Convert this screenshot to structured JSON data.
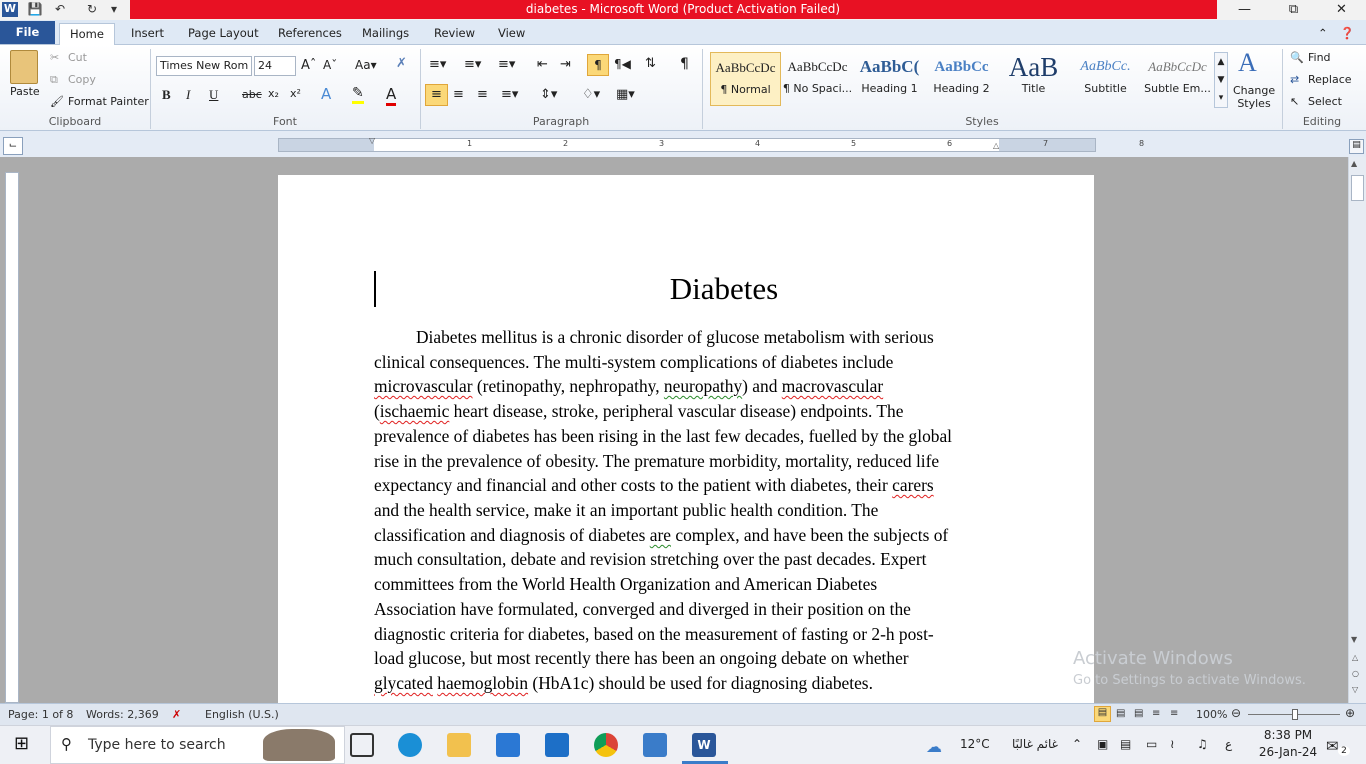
{
  "window": {
    "title": "diabetes - Microsoft Word (Product Activation Failed)"
  },
  "tabs": {
    "file": "File",
    "home": "Home",
    "insert": "Insert",
    "page_layout": "Page Layout",
    "references": "References",
    "mailings": "Mailings",
    "review": "Review",
    "view": "View"
  },
  "clipboard": {
    "paste": "Paste",
    "cut": "Cut",
    "copy": "Copy",
    "format_painter": "Format Painter",
    "label": "Clipboard"
  },
  "font": {
    "name": "Times New Rom",
    "size": "24",
    "label": "Font",
    "bold": "B",
    "italic": "I",
    "underline": "U",
    "strike": "abc",
    "subscript": "x₂",
    "superscript": "x²"
  },
  "paragraph": {
    "label": "Paragraph"
  },
  "styles": {
    "label": "Styles",
    "items": [
      {
        "preview": "AaBbCcDc",
        "name": "¶ Normal"
      },
      {
        "preview": "AaBbCcDc",
        "name": "¶ No Spaci..."
      },
      {
        "preview": "AaBbC(",
        "name": "Heading 1"
      },
      {
        "preview": "AaBbCc",
        "name": "Heading 2"
      },
      {
        "preview": "AaB",
        "name": "Title"
      },
      {
        "preview": "AaBbCc.",
        "name": "Subtitle"
      },
      {
        "preview": "AaBbCcDc",
        "name": "Subtle Em..."
      }
    ],
    "change_styles": "Change Styles"
  },
  "editing": {
    "find": "Find",
    "replace": "Replace",
    "select": "Select",
    "label": "Editing"
  },
  "document": {
    "title": "Diabetes",
    "lines": [
      "Diabetes mellitus is a chronic disorder of glucose metabolism with serious",
      "clinical consequences. The multi-system complications of diabetes include",
      "macrovascular line",
      "ischaemic line",
      "prevalence of diabetes has been rising in the last few decades, fuelled by the global",
      "rise in the prevalence of obesity. The premature morbidity, mortality, reduced life",
      "carers line",
      "and the health service, make it an important public health condition. The",
      "are line",
      "much consultation, debate and revision stretching over the past decades. Expert",
      "committees from the World Health Organization and American Diabetes",
      "Association have formulated, converged and diverged in their position on the",
      "diagnostic criteria for diabetes, based on the measurement of fasting or 2-h post-",
      "load glucose, but most recently there has been an ongoing debate on whether",
      "hba1c line"
    ],
    "segments": {
      "l3a": "microvascular",
      "l3b": " (retinopathy, nephropathy, ",
      "l3c": "neuropathy",
      "l3d": ") and ",
      "l3e": "macrovascular",
      "l4a": "(",
      "l4b": "ischaemic",
      "l4c": " heart disease, stroke, peripheral vascular disease) endpoints. The",
      "l7a": "expectancy and financial and other costs to the patient with diabetes, their ",
      "l7b": "carers",
      "l9a": "classification and diagnosis of diabetes ",
      "l9b": "are",
      "l9c": " complex, and have been the subjects of",
      "l15a": "glycated",
      "l15b": " ",
      "l15c": "haemoglobin",
      "l15d": " (HbA1c) should be used for diagnosing diabetes."
    }
  },
  "status": {
    "page": "Page: 1 of 8",
    "words": "Words: 2,369",
    "language": "English (U.S.)",
    "zoom": "100%"
  },
  "watermark": {
    "line1": "Activate Windows",
    "line2": "Go to Settings to activate Windows."
  },
  "taskbar": {
    "search_placeholder": "Type here to search",
    "weather": "12°C",
    "weather_desc": "غائم غالبًا",
    "lang": "ع",
    "time": "8:38 PM",
    "date": "26-Jan-24",
    "notif_count": "2"
  }
}
